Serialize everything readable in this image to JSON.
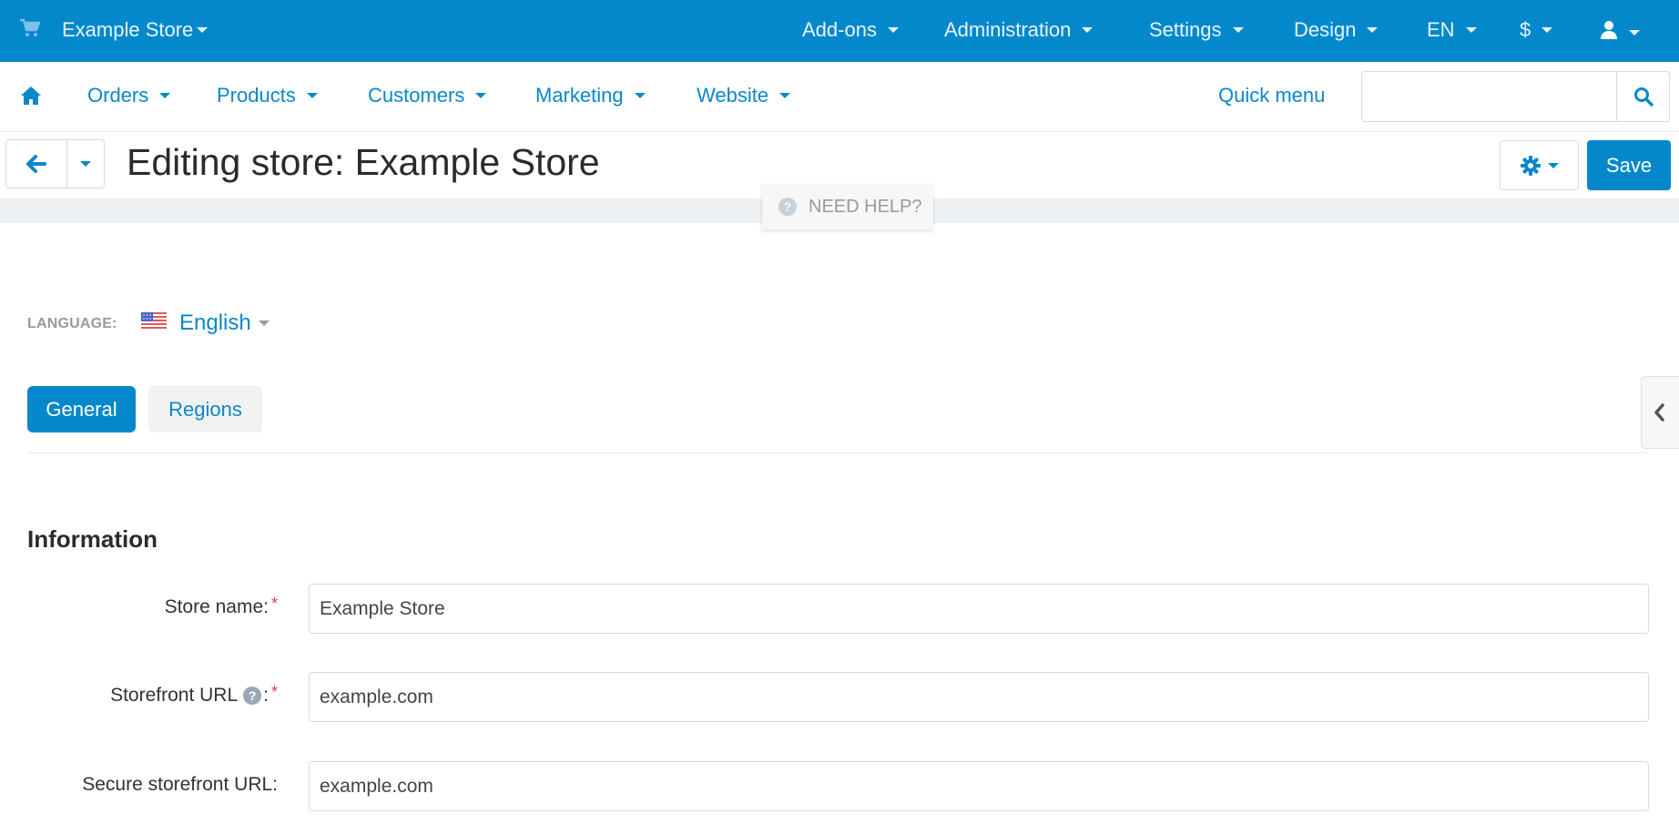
{
  "topbar": {
    "store_name": "Example Store",
    "menus": [
      {
        "label": "Add-ons"
      },
      {
        "label": "Administration"
      },
      {
        "label": "Settings"
      },
      {
        "label": "Design"
      },
      {
        "label": "EN"
      },
      {
        "label": "$"
      }
    ],
    "icons": {
      "cart": "cart-icon",
      "user": "user-icon"
    }
  },
  "navbar": {
    "items": [
      {
        "label": "Orders"
      },
      {
        "label": "Products"
      },
      {
        "label": "Customers"
      },
      {
        "label": "Marketing"
      },
      {
        "label": "Website"
      }
    ],
    "quick_menu": "Quick menu",
    "search": {
      "value": "",
      "placeholder": ""
    }
  },
  "titlebar": {
    "title": "Editing store: Example Store",
    "save_label": "Save"
  },
  "help": {
    "label": "NEED HELP?"
  },
  "language": {
    "label": "LANGUAGE:",
    "value": "English"
  },
  "tabs": [
    {
      "label": "General",
      "active": true
    },
    {
      "label": "Regions",
      "active": false
    }
  ],
  "section": {
    "title": "Information"
  },
  "form": {
    "fields": [
      {
        "label": "Store name:",
        "value": "Example Store",
        "required": true,
        "tooltip": false
      },
      {
        "label": "Storefront URL",
        "value": "example.com",
        "required": true,
        "tooltip": true
      },
      {
        "label": "Secure storefront URL:",
        "value": "example.com",
        "required": false,
        "tooltip": false
      }
    ]
  },
  "colors": {
    "brand": "#0388cc",
    "link": "#0a88c8",
    "required": "#e23b4a"
  }
}
